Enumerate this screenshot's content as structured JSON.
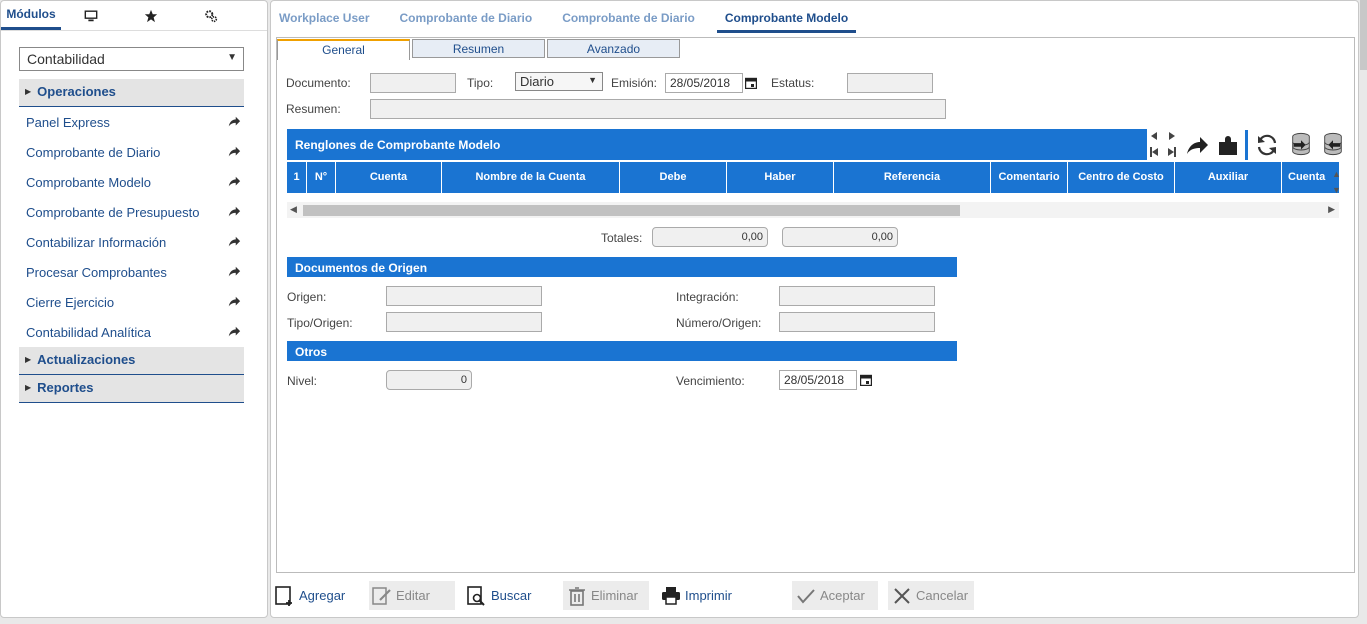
{
  "left": {
    "tabs": [
      {
        "label": "Módulos",
        "icon": "modules"
      },
      {
        "label": "",
        "icon": "monitor-icon"
      },
      {
        "label": "",
        "icon": "star-icon"
      },
      {
        "label": "",
        "icon": "settings-icon"
      }
    ],
    "module_select": "Contabilidad",
    "sections": {
      "operaciones": "Operaciones",
      "actualizaciones": "Actualizaciones",
      "reportes": "Reportes"
    },
    "items": [
      {
        "label": "Panel Express"
      },
      {
        "label": "Comprobante de Diario"
      },
      {
        "label": "Comprobante Modelo"
      },
      {
        "label": "Comprobante de Presupuesto"
      },
      {
        "label": "Contabilizar Información"
      },
      {
        "label": "Procesar Comprobantes"
      },
      {
        "label": "Cierre Ejercicio"
      },
      {
        "label": "Contabilidad Analítica"
      }
    ]
  },
  "top_tabs": [
    "Workplace User",
    "Comprobante de Diario",
    "Comprobante de Diario",
    "Comprobante Modelo"
  ],
  "sub_tabs": [
    "General",
    "Resumen",
    "Avanzado"
  ],
  "form": {
    "documento_label": "Documento:",
    "tipo_label": "Tipo:",
    "tipo_value": "Diario",
    "emision_label": "Emisión:",
    "emision_value": "28/05/2018",
    "estatus_label": "Estatus:",
    "resumen_label": "Resumen:"
  },
  "renglones": {
    "title": "Renglones de Comprobante Modelo",
    "columns": [
      "1",
      "N°",
      "Cuenta",
      "Nombre de la Cuenta",
      "Debe",
      "Haber",
      "Referencia",
      "Comentario",
      "Centro de Costo",
      "Auxiliar",
      "Cuenta"
    ]
  },
  "totales": {
    "label": "Totales:",
    "debe": "0,00",
    "haber": "0,00"
  },
  "documentos_origen": {
    "title": "Documentos de Origen",
    "origen_label": "Origen:",
    "integracion_label": "Integración:",
    "tipo_origen_label": "Tipo/Origen:",
    "numero_origen_label": "Número/Origen:"
  },
  "otros": {
    "title": "Otros",
    "nivel_label": "Nivel:",
    "nivel_value": "0",
    "vencimiento_label": "Vencimiento:",
    "vencimiento_value": "28/05/2018"
  },
  "actions": {
    "agregar": "Agregar",
    "editar": "Editar",
    "buscar": "Buscar",
    "eliminar": "Eliminar",
    "imprimir": "Imprimir",
    "aceptar": "Aceptar",
    "cancelar": "Cancelar"
  },
  "colors": {
    "accent": "#1a74d2",
    "nav_text": "#1f4e8c",
    "tab_highlight": "#f0a000"
  }
}
